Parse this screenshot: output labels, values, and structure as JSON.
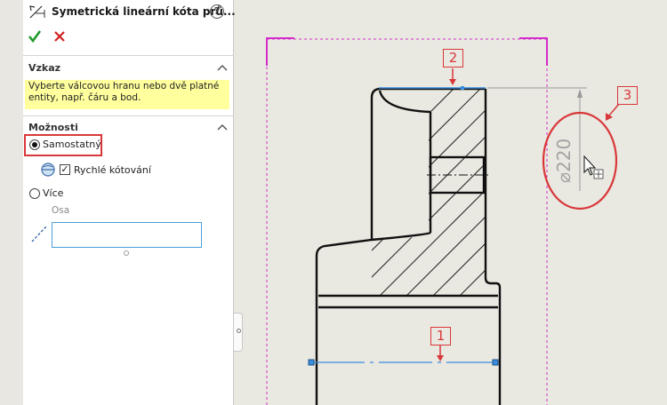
{
  "panel": {
    "title": "Symetrická lineární kóta prů...",
    "help_icon": "help-icon",
    "ok_icon": "checkmark-icon",
    "cancel_icon": "close-icon",
    "colors": {
      "ok": "#1e9a2a",
      "cancel": "#d12020",
      "highlight": "#d9383a",
      "hint_bg": "#ffff9e"
    }
  },
  "message_section": {
    "title": "Vzkaz",
    "text_line1": "Vyberte válcovou hranu nebo dvě platné",
    "text_line2": "entity, např. čáru a bod."
  },
  "options_section": {
    "title": "Možnosti",
    "single_label": "Samostatný",
    "single_checked": true,
    "quick_label": "Rychlé kótování",
    "quick_checked": true,
    "check_glyph": "✓",
    "multiple_label": "Více",
    "axis_caption": "Osa",
    "axis_value": ""
  },
  "drawing": {
    "callouts": {
      "c1": "1",
      "c2": "2",
      "c3": "3"
    },
    "dimension_text": "⌀220"
  }
}
